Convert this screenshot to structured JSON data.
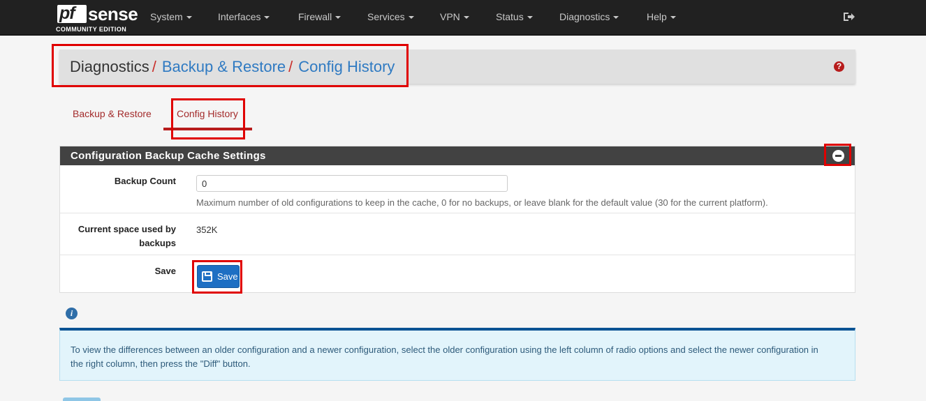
{
  "brand": {
    "logo_pf": "pf",
    "logo_sense": "sense",
    "edition": "COMMUNITY EDITION"
  },
  "nav": {
    "items": [
      {
        "label": "System"
      },
      {
        "label": "Interfaces"
      },
      {
        "label": "Firewall"
      },
      {
        "label": "Services"
      },
      {
        "label": "VPN"
      },
      {
        "label": "Status"
      },
      {
        "label": "Diagnostics"
      },
      {
        "label": "Help"
      }
    ],
    "logout_icon": "sign-out-icon"
  },
  "breadcrumb": {
    "root": "Diagnostics",
    "separator": "/",
    "level1": "Backup & Restore",
    "level2": "Config History",
    "help_icon": "question-circle-icon",
    "help_glyph": "?"
  },
  "tabs": [
    {
      "label": "Backup & Restore",
      "active": false
    },
    {
      "label": "Config History",
      "active": true
    }
  ],
  "panel": {
    "title": "Configuration Backup Cache Settings",
    "collapse_icon": "minus-circle-icon",
    "backup_count": {
      "label": "Backup Count",
      "value": "0",
      "help": "Maximum number of old configurations to keep in the cache, 0 for no backups, or leave blank for the default value (30 for the current platform)."
    },
    "space_used": {
      "label_line1": "Current space used by",
      "label_line2": "backups",
      "value": "352K"
    },
    "save": {
      "label": "Save",
      "button_label": "Save",
      "icon": "floppy-disk-icon"
    }
  },
  "info": {
    "icon": "info-circle-icon",
    "glyph": "i",
    "text": "To view the differences between an older configuration and a newer configuration, select the older configuration using the left column of radio options and select the newer configuration in the right column, then press the \"Diff\" button."
  },
  "colors": {
    "navbar": "#212121",
    "link": "#2f7ac2",
    "accent_red": "#b71c1c",
    "panel_heading": "#424242",
    "primary_button": "#1e6fc3",
    "info_border": "#0b5394"
  }
}
